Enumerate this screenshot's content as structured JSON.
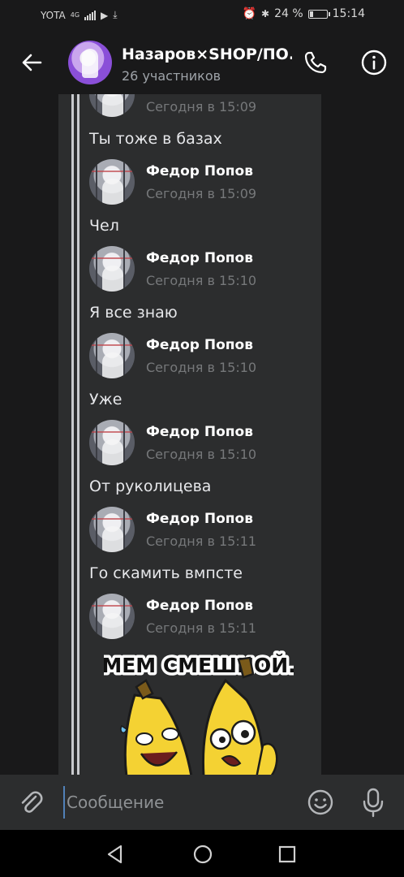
{
  "status_bar": {
    "carrier": "YOTA",
    "network": "4G",
    "battery": "24 %",
    "battery_level": 0.24,
    "time": "15:14",
    "icons": [
      "alarm-icon",
      "bluetooth-icon",
      "vibrate-icon",
      "battery-icon",
      "play-icon",
      "download-icon"
    ]
  },
  "header": {
    "title": "Назаров×SHOP/ПО.",
    "subtitle": "26 участников",
    "icons": [
      "back-arrow-icon",
      "phone-icon",
      "info-icon"
    ]
  },
  "messages": [
    {
      "name": "",
      "time": "Сегодня в 15:09",
      "text": "Ты тоже в базах"
    },
    {
      "name": "Федор Попов",
      "time": "Сегодня в 15:09",
      "text": "Чел"
    },
    {
      "name": "Федор Попов",
      "time": "Сегодня в 15:10",
      "text": "Я все знаю"
    },
    {
      "name": "Федор Попов",
      "time": "Сегодня в 15:10",
      "text": "Уже"
    },
    {
      "name": "Федор Попов",
      "time": "Сегодня в 15:10",
      "text": "От руколицева"
    },
    {
      "name": "Федор Попов",
      "time": "Сегодня в 15:11",
      "text": "Го скамить вмпсте"
    },
    {
      "name": "Федор Попов",
      "time": "Сегодня в 15:11",
      "text": ""
    }
  ],
  "sticker": {
    "caption": "МЕМ СМЕШНОЙ."
  },
  "composer": {
    "placeholder": "Сообщение",
    "icons": [
      "paperclip-icon",
      "emoji-icon",
      "microphone-icon"
    ]
  },
  "nav": {
    "icons": [
      "nav-back-icon",
      "nav-home-icon",
      "nav-recents-icon"
    ]
  },
  "colors": {
    "background": "#19191a",
    "panel": "#2c2d2e",
    "accent": "#5181b8",
    "time_gray": "#76787a"
  }
}
